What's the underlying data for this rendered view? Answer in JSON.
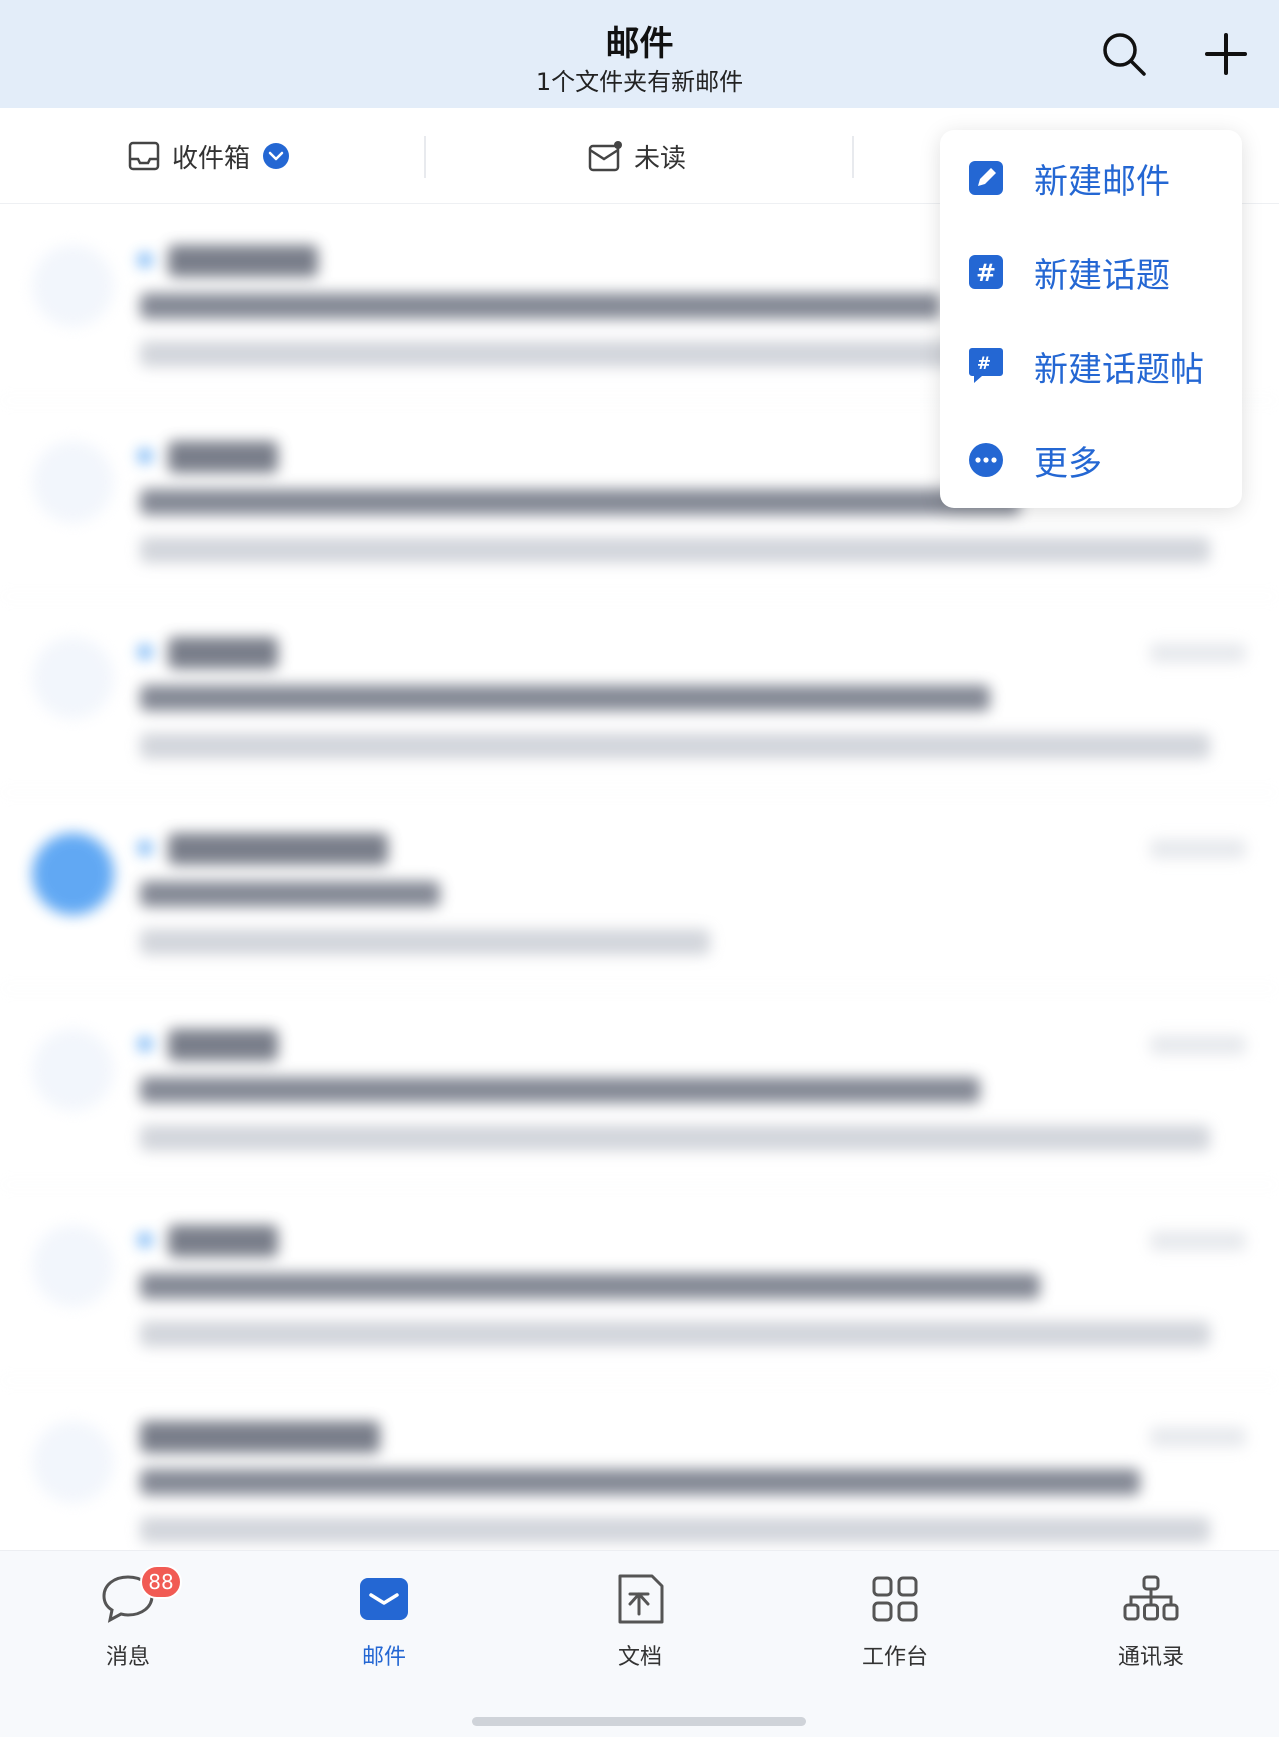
{
  "header": {
    "title": "邮件",
    "subtitle": "1个文件夹有新邮件",
    "search_icon": "search-icon",
    "add_icon": "plus-icon"
  },
  "filters": {
    "inbox_label": "收件箱",
    "unread_label": "未读"
  },
  "menu": {
    "items": [
      {
        "label": "新建邮件",
        "icon": "compose-icon"
      },
      {
        "label": "新建话题",
        "icon": "hashtag-icon"
      },
      {
        "label": "新建话题帖",
        "icon": "topic-post-icon"
      },
      {
        "label": "更多",
        "icon": "more-icon"
      }
    ]
  },
  "mail_list": {
    "rows": [
      {
        "avatar": "",
        "avatar_style": "light"
      },
      {
        "avatar": "",
        "avatar_style": "light"
      },
      {
        "avatar": "",
        "avatar_style": "light"
      },
      {
        "avatar": "",
        "avatar_style": "blue"
      },
      {
        "avatar": "",
        "avatar_style": "light"
      },
      {
        "avatar": "",
        "avatar_style": "light"
      },
      {
        "avatar": "",
        "avatar_style": "light"
      }
    ]
  },
  "tabbar": {
    "items": [
      {
        "label": "消息",
        "icon": "chat-bubble-icon",
        "badge": "88"
      },
      {
        "label": "邮件",
        "icon": "mail-icon",
        "active": true
      },
      {
        "label": "文档",
        "icon": "document-icon"
      },
      {
        "label": "工作台",
        "icon": "grid-icon"
      },
      {
        "label": "通讯录",
        "icon": "org-chart-icon"
      }
    ]
  },
  "colors": {
    "accent": "#2467d3",
    "header_bg": "#e3edf9",
    "badge": "#f15b54"
  }
}
